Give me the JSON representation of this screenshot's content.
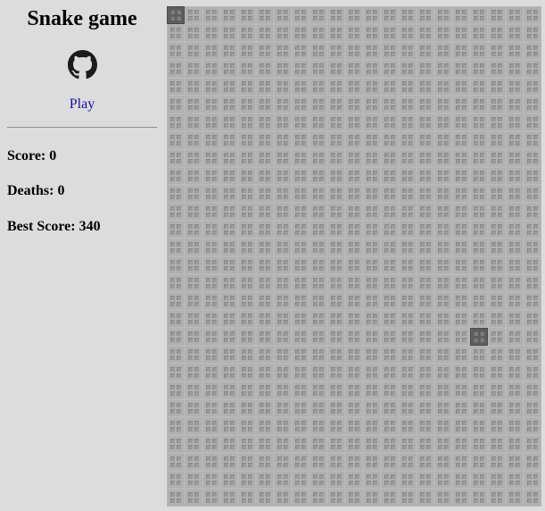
{
  "sidebar": {
    "title": "Snake game",
    "github_icon": "github-icon",
    "play_label": "Play",
    "score": "Score: 0",
    "deaths": "Deaths: 0",
    "best_score": "Best Score: 340"
  },
  "board": {
    "columns": 21,
    "rows": 28,
    "snake_cells": [
      [
        0,
        0
      ]
    ],
    "food_cells": [
      [
        17,
        18
      ]
    ],
    "colors": {
      "background": "#dcdcdc",
      "empty_cell": "#b0b0b0",
      "active_cell": "#5e5e5e",
      "play_link": "#1a0dab"
    }
  }
}
